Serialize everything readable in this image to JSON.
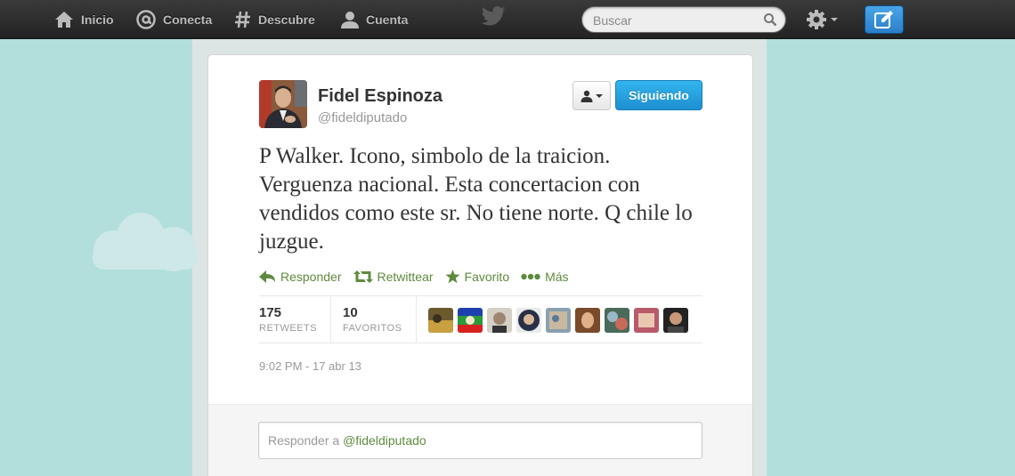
{
  "nav": {
    "home": "Inicio",
    "connect": "Conecta",
    "discover": "Descubre",
    "account": "Cuenta"
  },
  "search": {
    "placeholder": "Buscar"
  },
  "tweet": {
    "author_name": "Fidel Espinoza",
    "author_handle": "@fideldiputado",
    "follow_label": "Siguiendo",
    "text": "P Walker. Icono, simbolo de la traicion. Verguenza nacional. Esta concertacion con vendidos como este sr. No tiene norte. Q chile lo juzgue.",
    "actions": {
      "reply": "Responder",
      "retweet": "Retwittear",
      "favorite": "Favorito",
      "more": "Más"
    },
    "stats": {
      "retweets_count": "175",
      "retweets_label": "RETWEETS",
      "favorites_count": "10",
      "favorites_label": "FAVORITOS"
    },
    "timestamp": "9:02 PM - 17 abr 13"
  },
  "reply": {
    "prefix": "Responder a ",
    "mention": "@fideldiputado"
  },
  "colors": {
    "background": "#b2dfdc",
    "action_green": "#5e8a3e",
    "follow_blue": "#2a9ee0"
  }
}
